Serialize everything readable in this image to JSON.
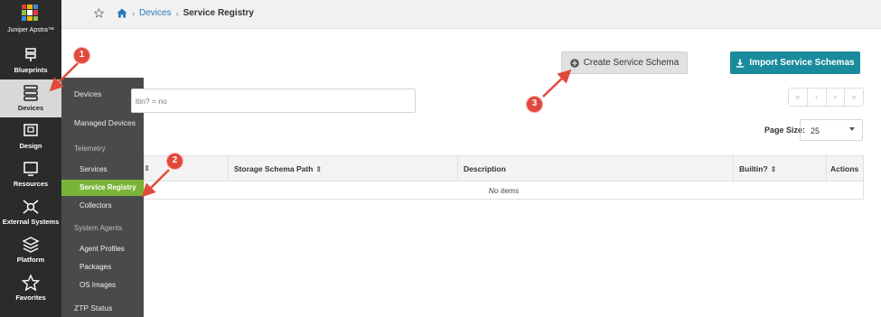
{
  "app": {
    "logo_text": "Juniper Apstra™"
  },
  "rail": {
    "items": [
      {
        "label": "Blueprints",
        "icon": "blueprints-icon"
      },
      {
        "label": "Devices",
        "icon": "devices-icon"
      },
      {
        "label": "Design",
        "icon": "design-icon"
      },
      {
        "label": "Resources",
        "icon": "resources-icon"
      },
      {
        "label": "External Systems",
        "icon": "external-systems-icon"
      },
      {
        "label": "Platform",
        "icon": "platform-icon"
      },
      {
        "label": "Favorites",
        "icon": "star-icon"
      }
    ]
  },
  "flyout": {
    "devices": "Devices",
    "managed_devices": "Managed Devices",
    "telemetry": "Telemetry",
    "services": "Services",
    "service_registry": "Service Registry",
    "collectors": "Collectors",
    "system_agents": "System Agents",
    "agent_profiles": "Agent Profiles",
    "packages": "Packages",
    "os_images": "OS Images",
    "ztp_status": "ZTP Status"
  },
  "breadcrumb": {
    "devices": "Devices",
    "current": "Service Registry"
  },
  "actions": {
    "create": "Create Service Schema",
    "import": "Import Service Schemas"
  },
  "filter": {
    "text": "ltin? = no"
  },
  "pager": {
    "first": "«",
    "prev": "‹",
    "next": "›",
    "last": "»"
  },
  "page_size": {
    "label": "Page Size:",
    "value": "25"
  },
  "table": {
    "columns": [
      "Storage Schema Path",
      "Description",
      "Builtin?",
      "Actions"
    ],
    "empty_text": "No items"
  },
  "callouts": [
    "1",
    "2",
    "3"
  ],
  "colors": {
    "rail_bg": "#2b2b2b",
    "flyout_bg": "#4a4a4a",
    "active_green": "#79b438",
    "import_teal": "#1a8b9c",
    "callout_red": "#e0493c",
    "link_blue": "#2a7ab8"
  }
}
